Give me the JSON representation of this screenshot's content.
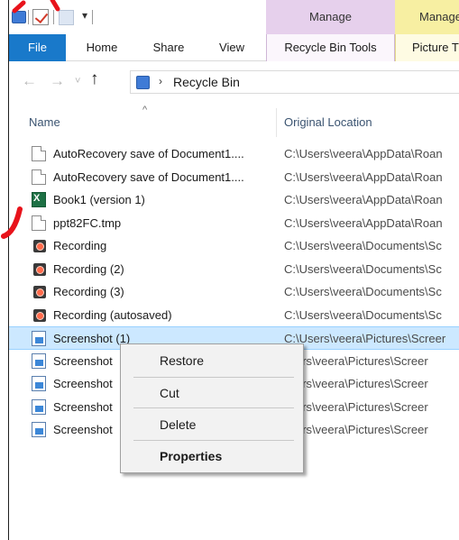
{
  "ribbon": {
    "context_tabs": [
      "Manage",
      "Manage"
    ],
    "tabs": [
      "File",
      "Home",
      "Share",
      "View",
      "Recycle Bin Tools",
      "Picture T"
    ],
    "qa_dropdown": "▾"
  },
  "address": {
    "path": "Recycle Bin",
    "chevron": "›"
  },
  "nav": {
    "back": "←",
    "forward": "→",
    "history": "˅",
    "up": "↑"
  },
  "columns": {
    "sort_indicator": "^",
    "name": "Name",
    "original_location": "Original Location"
  },
  "files": [
    {
      "name": "AutoRecovery save of Document1....",
      "location": "C:\\Users\\veera\\AppData\\Roan",
      "icon": "document-icon"
    },
    {
      "name": "AutoRecovery save of Document1....",
      "location": "C:\\Users\\veera\\AppData\\Roan",
      "icon": "document-icon"
    },
    {
      "name": "Book1 (version 1)",
      "location": "C:\\Users\\veera\\AppData\\Roan",
      "icon": "excel-icon"
    },
    {
      "name": "ppt82FC.tmp",
      "location": "C:\\Users\\veera\\AppData\\Roan",
      "icon": "document-icon"
    },
    {
      "name": "Recording",
      "location": "C:\\Users\\veera\\Documents\\Sc",
      "icon": "recording-icon"
    },
    {
      "name": "Recording (2)",
      "location": "C:\\Users\\veera\\Documents\\Sc",
      "icon": "recording-icon"
    },
    {
      "name": "Recording (3)",
      "location": "C:\\Users\\veera\\Documents\\Sc",
      "icon": "recording-icon"
    },
    {
      "name": "Recording (autosaved)",
      "location": "C:\\Users\\veera\\Documents\\Sc",
      "icon": "recording-icon"
    },
    {
      "name": "Screenshot (1)",
      "location": "C:\\Users\\veera\\Pictures\\Screer",
      "icon": "image-icon"
    },
    {
      "name": "Screenshot",
      "location": "Jsers\\veera\\Pictures\\Screer",
      "icon": "image-icon"
    },
    {
      "name": "Screenshot",
      "location": "Jsers\\veera\\Pictures\\Screer",
      "icon": "image-icon"
    },
    {
      "name": "Screenshot",
      "location": "Jsers\\veera\\Pictures\\Screer",
      "icon": "image-icon"
    },
    {
      "name": "Screenshot",
      "location": "Jsers\\veera\\Pictures\\Screer",
      "icon": "image-icon"
    }
  ],
  "context_menu": {
    "restore": "Restore",
    "cut": "Cut",
    "delete": "Delete",
    "properties": "Properties"
  },
  "colors": {
    "file_tab": "#1979ca",
    "selection": "#cce8ff",
    "manage_recycle": "#e6d0ec",
    "manage_picture": "#f7efa2",
    "annotation": "#e8131b"
  }
}
